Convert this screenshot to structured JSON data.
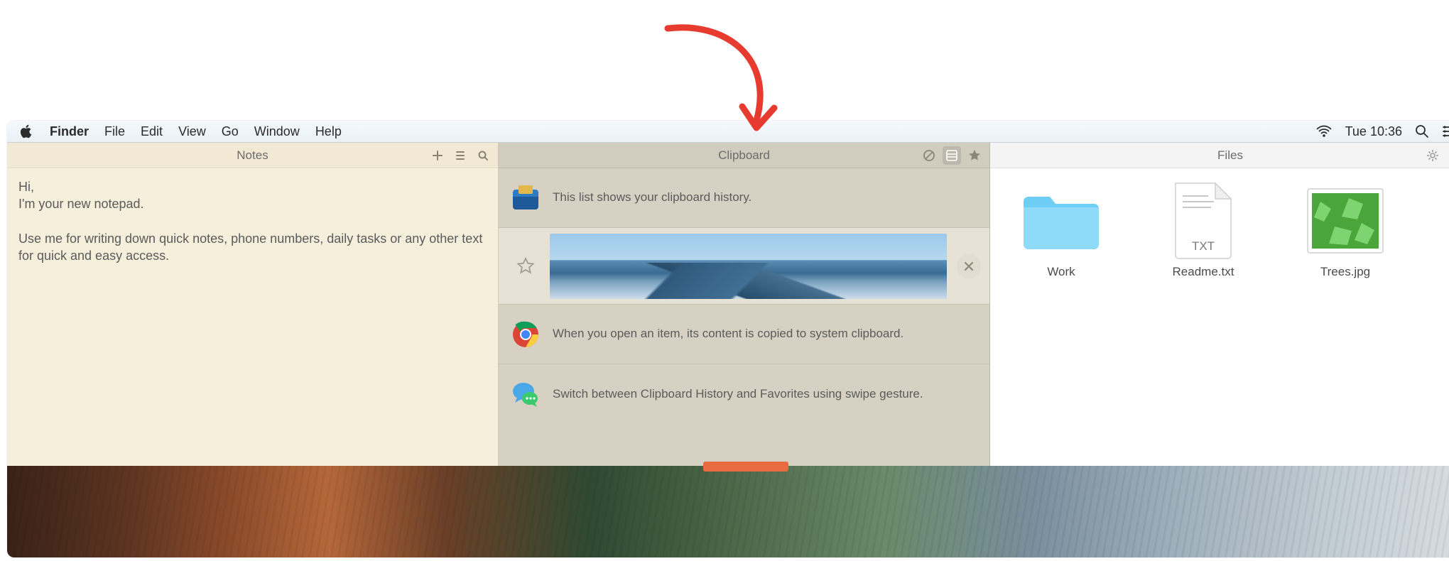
{
  "menubar": {
    "app_name": "Finder",
    "items": [
      "File",
      "Edit",
      "View",
      "Go",
      "Window",
      "Help"
    ],
    "clock": "Tue 10:36"
  },
  "notes": {
    "title": "Notes",
    "body_line1": "Hi,",
    "body_line2": "I'm your new notepad.",
    "body_para2": "Use me for writing down quick notes, phone numbers, daily tasks or any other text for quick and easy access."
  },
  "clipboard": {
    "title": "Clipboard",
    "rows": {
      "r0": "This list shows your clipboard history.",
      "r2": "When you open an item, its content is copied to system clipboard.",
      "r3": "Switch between Clipboard History and Favorites using swipe gesture."
    }
  },
  "files": {
    "title": "Files",
    "items": {
      "work": "Work",
      "readme": "Readme.txt",
      "readme_badge": "TXT",
      "trees": "Trees.jpg"
    }
  }
}
